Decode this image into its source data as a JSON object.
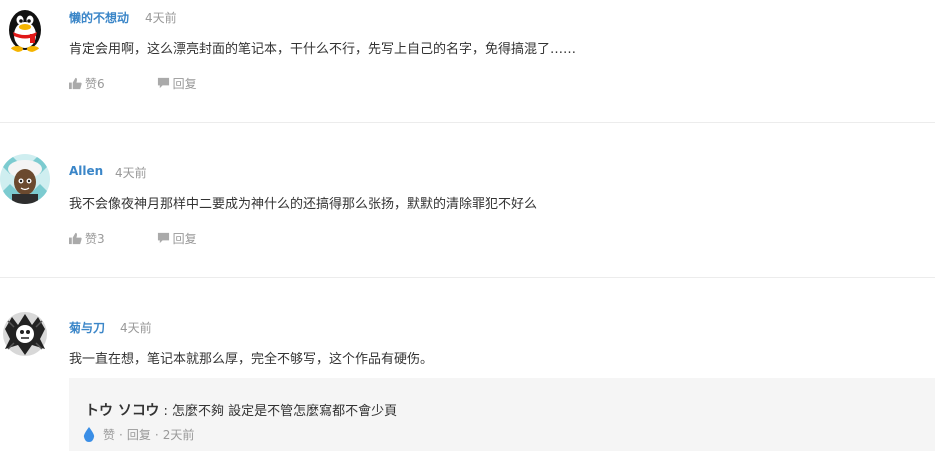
{
  "comments": [
    {
      "user": "懒的不想动",
      "time": "4天前",
      "content": "肯定会用啊，这么漂亮封面的笔记本，干什么不行，先写上自己的名字，免得搞混了……",
      "like_label": "赞6",
      "reply_label": "回复",
      "avatar_icon": "qq-penguin-avatar"
    },
    {
      "user": "Allen",
      "time": "4天前",
      "content": "我不会像夜神月那样中二要成为神什么的还搞得那么张扬，默默的清除罪犯不好么",
      "like_label": "赞3",
      "reply_label": "回复",
      "avatar_icon": "anime-character-avatar"
    },
    {
      "user": "菊与刀",
      "time": "4天前",
      "content": "我一直在想，笔记本就那么厚，完全不够写，这个作品有硬伤。",
      "like_label": "",
      "reply_label": "",
      "avatar_icon": "monochrome-art-avatar",
      "reply": {
        "author": "トウ ソコウ",
        "separator": " : ",
        "text": "怎麼不夠 設定是不管怎麼寫都不會少頁",
        "like_label": "赞",
        "dot": "·",
        "reply_label": "回复",
        "time": "2天前",
        "drop_icon": "water-drop-icon"
      }
    }
  ],
  "colors": {
    "username": "#3b86c8",
    "meta": "#999999",
    "reply_bg": "#f5f5f5",
    "divider": "#ececec",
    "drop": "#3a8ee6"
  }
}
